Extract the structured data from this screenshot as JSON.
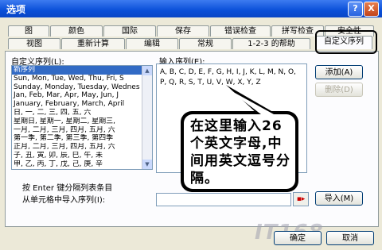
{
  "window": {
    "title": "选项",
    "help_label": "?",
    "close_label": "X"
  },
  "tabs_row1": [
    "图",
    "颜色",
    "国际",
    "保存",
    "错误检查",
    "拼写检查",
    "安全性"
  ],
  "tabs_row2": [
    "视图",
    "重新计算",
    "编辑",
    "常规",
    "1-2-3 的帮助",
    "自定义序列"
  ],
  "left": {
    "label": "自定义序列(L):",
    "items": [
      "新序列",
      "Sun, Mon, Tue, Wed, Thu, Fri, S",
      "Sunday, Monday, Tuesday, Wednes",
      "Jan, Feb, Mar, Apr, May, Jun, J",
      "January, February, March, April",
      "日, 一, 二, 三, 四, 五, 六",
      "星期日, 星期一, 星期二, 星期三,",
      "一月, 二月, 三月, 四月, 五月, 六",
      "第一季, 第二季, 第三季, 第四季",
      "正月, 二月, 三月, 四月, 五月, 六",
      "子, 丑, 寅, 卯, 辰, 巳, 午, 未",
      "甲, 乙, 丙, 丁, 戊, 己, 庚, 辛"
    ],
    "scroll_up": "▲",
    "scroll_down": "▼"
  },
  "input": {
    "label": "输入序列(E):",
    "value": "A, B, C, D, E, F, G, H, I, J, K, L, M, N, O, P, Q, R, S, T, U, V, W, X, Y, Z"
  },
  "buttons": {
    "add": "添加(A)",
    "delete": "删除(D)",
    "import": "导入(M)",
    "ok": "确定",
    "cancel": "取消"
  },
  "hint": "按 Enter 键分隔列表条目",
  "import_label": "从单元格中导入序列(I):",
  "import_ref_icon": "range-select-icon",
  "callout": {
    "text": "在这里输入26个英文字母,中间用英文逗号分隔。"
  },
  "watermark": "IT168",
  "colors": {
    "titlebar": "#0a4fd8",
    "selection": "#316ac5",
    "dialog": "#ece9d8"
  }
}
